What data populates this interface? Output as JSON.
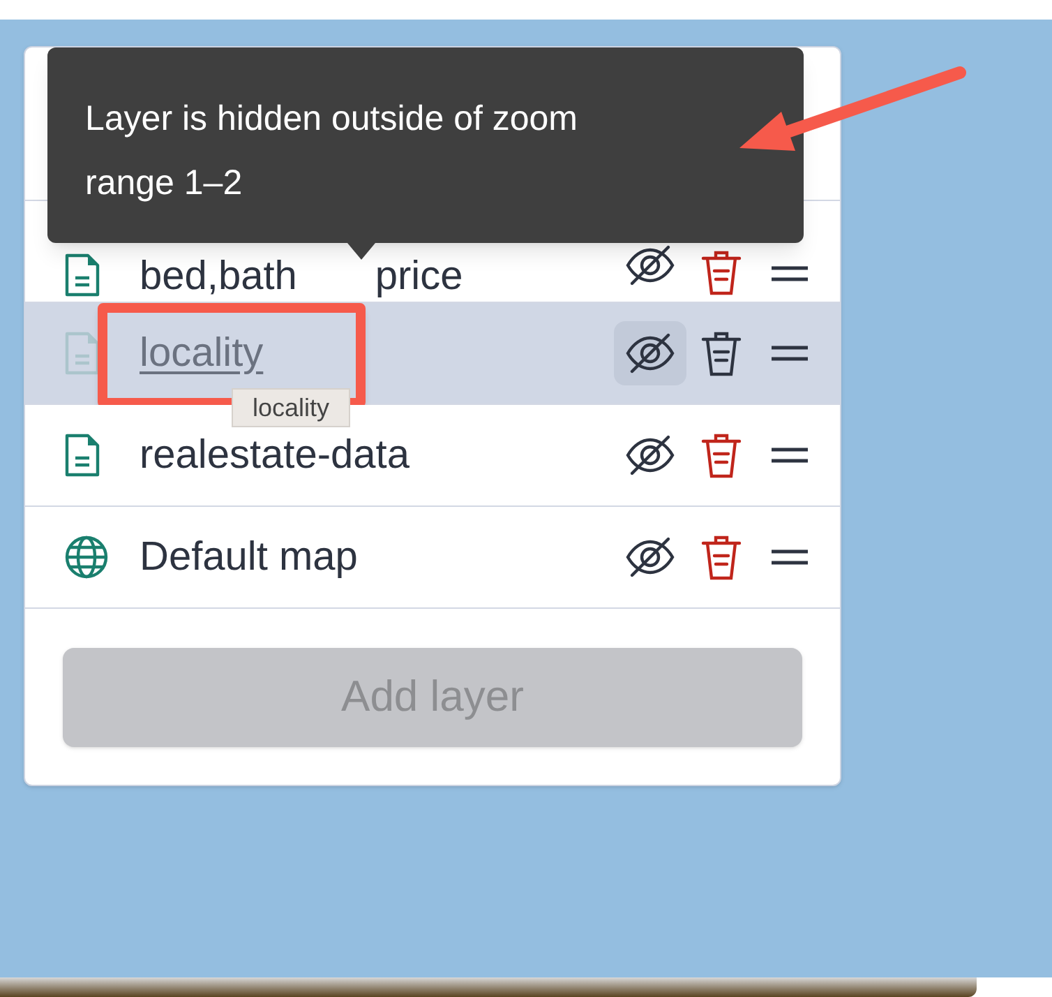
{
  "tooltip": {
    "lines": [
      "Layer is hidden outside of zoom",
      "range 1–2"
    ]
  },
  "layers": [
    {
      "kind": "document",
      "label_parts": [
        "bed,bath",
        "price"
      ],
      "highlighted": false
    },
    {
      "kind": "document",
      "label_parts": [
        "locality"
      ],
      "highlighted": true,
      "hint": "locality"
    },
    {
      "kind": "document",
      "label_parts": [
        "realestate-data"
      ],
      "highlighted": false
    },
    {
      "kind": "globe",
      "label_parts": [
        "Default map"
      ],
      "highlighted": false
    }
  ],
  "add_button": {
    "label": "Add layer",
    "disabled": true
  }
}
